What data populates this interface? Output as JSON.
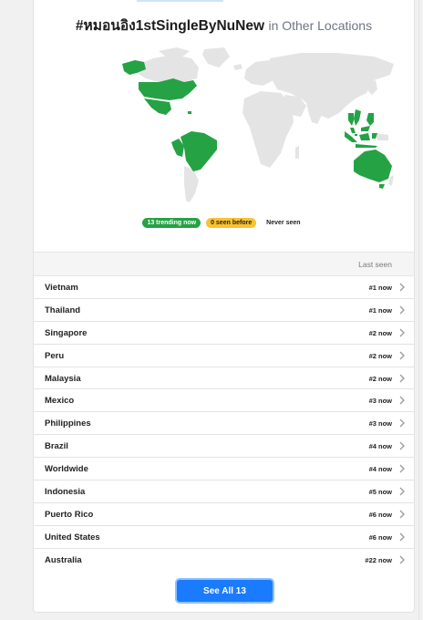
{
  "header": {
    "hashtag": "#หมอนอิง1stSingleByNuNew",
    "suffix": "in Other Locations"
  },
  "legend": {
    "trending": "13 trending now",
    "seen_before": "0 seen before",
    "never_seen": "Never seen"
  },
  "colors": {
    "trending": "#25a244",
    "seen_before": "#f9c22e",
    "never_seen": "#e4e4e4",
    "button": "#1a7bff"
  },
  "table": {
    "last_seen_label": "Last seen",
    "rows": [
      {
        "name": "Vietnam",
        "rank": "#1 now"
      },
      {
        "name": "Thailand",
        "rank": "#1 now"
      },
      {
        "name": "Singapore",
        "rank": "#2 now"
      },
      {
        "name": "Peru",
        "rank": "#2 now"
      },
      {
        "name": "Malaysia",
        "rank": "#2 now"
      },
      {
        "name": "Mexico",
        "rank": "#3 now"
      },
      {
        "name": "Philippines",
        "rank": "#3 now"
      },
      {
        "name": "Brazil",
        "rank": "#4 now"
      },
      {
        "name": "Worldwide",
        "rank": "#4 now"
      },
      {
        "name": "Indonesia",
        "rank": "#5 now"
      },
      {
        "name": "Puerto Rico",
        "rank": "#6 now"
      },
      {
        "name": "United States",
        "rank": "#6 now"
      },
      {
        "name": "Australia",
        "rank": "#22 now"
      }
    ]
  },
  "see_all_label": "See All 13"
}
